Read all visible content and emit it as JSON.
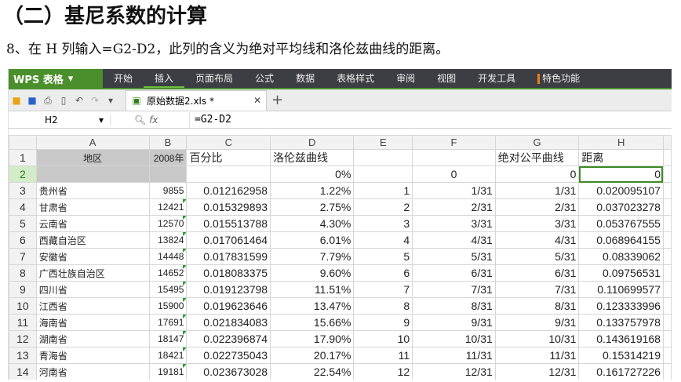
{
  "doc": {
    "heading": "（二）基尼系数的计算",
    "instruction": "8、在 H 列输入=G2-D2，此列的含义为绝对平均线和洛伦兹曲线的距离。"
  },
  "app": {
    "logo": "WPS 表格",
    "menus": [
      "开始",
      "插入",
      "页面布局",
      "公式",
      "数据",
      "表格样式",
      "审阅",
      "视图",
      "开发工具",
      "特色功能"
    ],
    "active_menu": "插入",
    "tab_name": "原始数据2.xls *",
    "name_box": "H2",
    "fx": "fx",
    "formula": "=G2-D2"
  },
  "sheet": {
    "columns": [
      "A",
      "B",
      "C",
      "D",
      "E",
      "F",
      "G",
      "H"
    ],
    "selected_column": "H",
    "active_cell": "H2",
    "row1": [
      "地区",
      "2008年",
      "百分比",
      "洛伦兹曲线",
      "",
      "",
      "绝对公平曲线",
      "距离"
    ],
    "row2": [
      "",
      "",
      "",
      "0%",
      "",
      "0",
      "0",
      "0"
    ],
    "rows": [
      [
        "贵州省",
        "9855",
        "0.012162958",
        "1.22%",
        "1",
        "1/31",
        "1/31",
        "0.020095107"
      ],
      [
        "甘肃省",
        "12421",
        "0.015329893",
        "2.75%",
        "2",
        "2/31",
        "2/31",
        "0.037023278"
      ],
      [
        "云南省",
        "12570",
        "0.015513788",
        "4.30%",
        "3",
        "3/31",
        "3/31",
        "0.053767555"
      ],
      [
        "西藏自治区",
        "13824",
        "0.017061464",
        "6.01%",
        "4",
        "4/31",
        "4/31",
        "0.068964155"
      ],
      [
        "安徽省",
        "14448",
        "0.017831599",
        "7.79%",
        "5",
        "5/31",
        "5/31",
        "0.08339062"
      ],
      [
        "广西壮族自治区",
        "14652",
        "0.018083375",
        "9.60%",
        "6",
        "6/31",
        "6/31",
        "0.09756531"
      ],
      [
        "四川省",
        "15495",
        "0.019123798",
        "11.51%",
        "7",
        "7/31",
        "7/31",
        "0.110699577"
      ],
      [
        "江西省",
        "15900",
        "0.019623646",
        "13.47%",
        "8",
        "8/31",
        "8/31",
        "0.123333996"
      ],
      [
        "海南省",
        "17691",
        "0.021834083",
        "15.66%",
        "9",
        "9/31",
        "9/31",
        "0.133757978"
      ],
      [
        "湖南省",
        "18147",
        "0.022396874",
        "17.90%",
        "10",
        "10/31",
        "10/31",
        "0.143619168"
      ],
      [
        "青海省",
        "18421",
        "0.022735043",
        "20.17%",
        "11",
        "11/31",
        "11/31",
        "0.15314219"
      ],
      [
        "河南省",
        "19181",
        "0.023673028",
        "22.54%",
        "12",
        "12/31",
        "12/31",
        "0.161727226"
      ]
    ]
  }
}
